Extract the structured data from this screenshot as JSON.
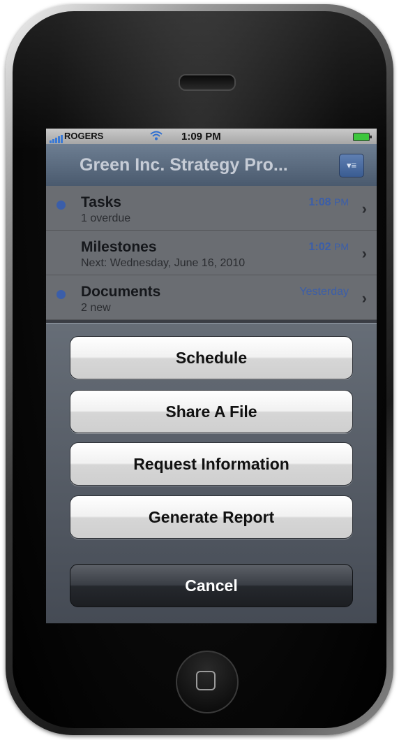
{
  "status_bar": {
    "carrier": "ROGERS",
    "time": "1:09 PM",
    "wifi_icon": "wifi-icon",
    "battery_icon": "battery-icon"
  },
  "nav": {
    "title": "Green Inc. Strategy Pro...",
    "menu_icon": "menu-icon"
  },
  "list": {
    "items": [
      {
        "title": "Tasks",
        "subtitle": "1 overdue",
        "time": "1:08",
        "ampm": "PM",
        "unread": true
      },
      {
        "title": "Milestones",
        "subtitle": "Next: Wednesday, June 16, 2010",
        "time": "1:02",
        "ampm": "PM",
        "unread": false
      },
      {
        "title": "Documents",
        "subtitle": "2 new",
        "time": "Yesterday",
        "ampm": "",
        "unread": true
      }
    ]
  },
  "action_sheet": {
    "buttons": [
      "Schedule",
      "Share A File",
      "Request Information",
      "Generate Report"
    ],
    "cancel": "Cancel"
  },
  "colors": {
    "accent": "#3b5ea9",
    "nav_bar": "#4a5a6e",
    "battery": "#3cc63c"
  }
}
